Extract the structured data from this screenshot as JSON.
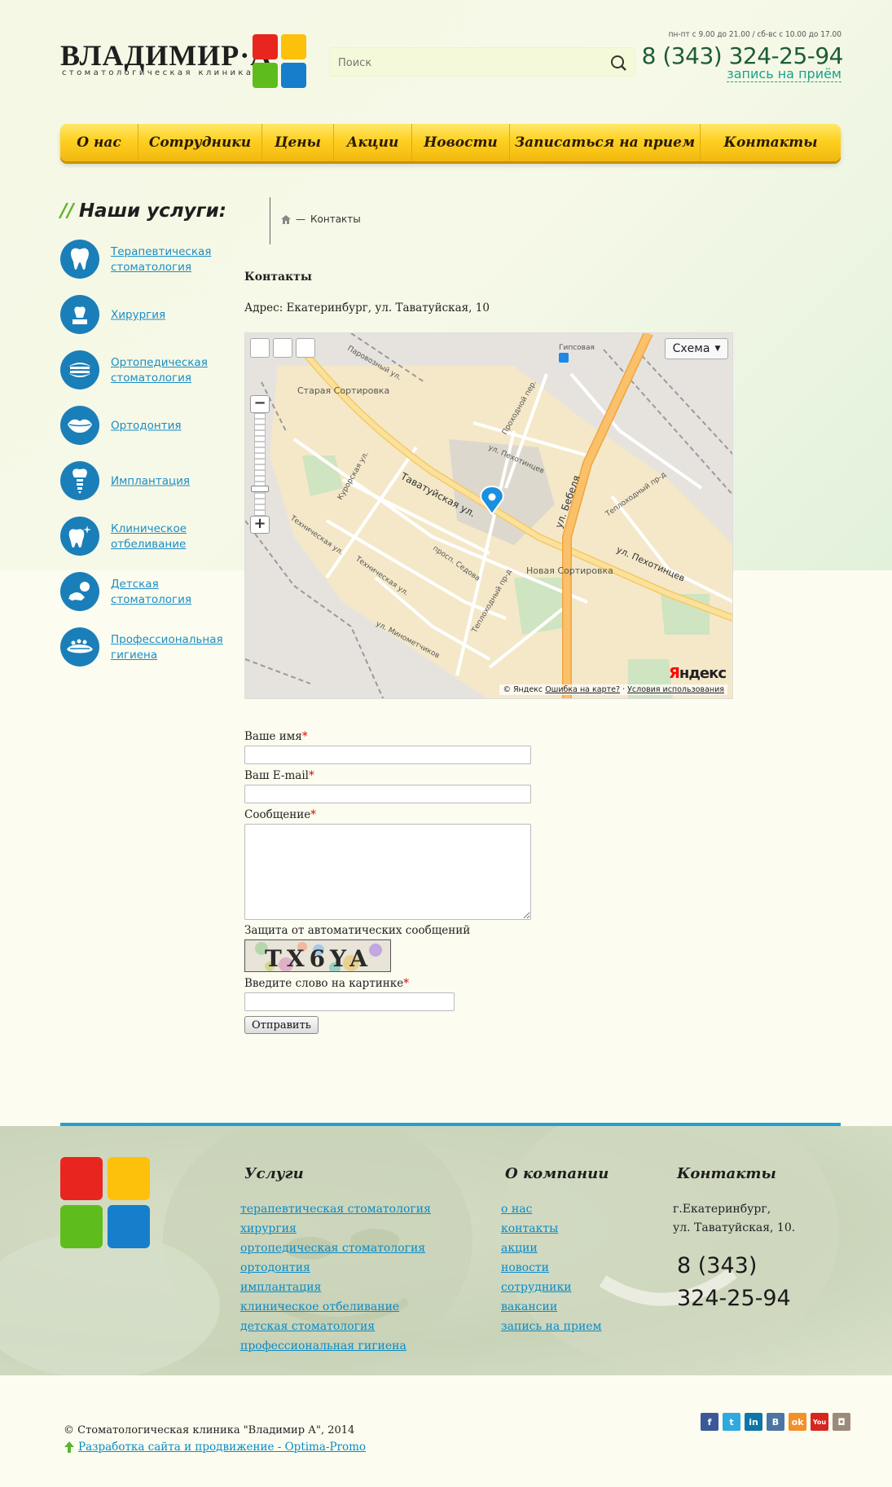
{
  "header": {
    "logo_text": "ВЛАДИМИР·А",
    "logo_subtitle": "стоматологическая клиника",
    "logo_colors": [
      "#e8261f",
      "#fdc10c",
      "#5ebd1c",
      "#157fcb"
    ],
    "search_placeholder": "Поиск",
    "hours": "пн-пт с 9.00 до 21.00 / сб-вс с 10.00 до 17.00",
    "phone": "8 (343) 324-25-94",
    "appointment_link": "запись на приём"
  },
  "menu": [
    {
      "label": "О нас"
    },
    {
      "label": "Сотрудники"
    },
    {
      "label": "Цены"
    },
    {
      "label": "Акции"
    },
    {
      "label": "Новости"
    },
    {
      "label": "Записаться на прием"
    },
    {
      "label": "Контакты"
    }
  ],
  "sidebar": {
    "title": "Наши услуги:",
    "items": [
      {
        "label": "Терапевтическая стоматология",
        "icon": "tooth-icon"
      },
      {
        "label": "Хирургия",
        "icon": "surgery-tooth-icon"
      },
      {
        "label": "Ортопедическая стоматология",
        "icon": "denture-icon"
      },
      {
        "label": "Ортодонтия",
        "icon": "lips-icon"
      },
      {
        "label": "Имплантация",
        "icon": "implant-icon"
      },
      {
        "label": "Клиническое отбеливание",
        "icon": "whitening-tooth-icon"
      },
      {
        "label": "Детская стоматология",
        "icon": "child-icon"
      },
      {
        "label": "Профессиональная гигиена",
        "icon": "hygiene-icon"
      }
    ]
  },
  "breadcrumb": {
    "separator": "—",
    "current": "Контакты"
  },
  "content": {
    "title": "Контакты",
    "address": "Адрес: Екатеринбург, ул. Таватуйская, 10"
  },
  "map": {
    "schema_label": "Схема",
    "labels": {
      "staraya": "Старая Сортировка",
      "tavatuyskaya": "Таватуйская ул.",
      "bebelya": "ул. Бебеля",
      "pekhotintsev": "ул. Пехотинцев",
      "pekhotintsev2": "ул. Пехотинцев",
      "novaya": "Новая Сортировка",
      "tekhnicheskaya": "Техническая ул.",
      "tekhnicheskaya2": "Техническая ул.",
      "kurorskaya": "Курорская ул.",
      "sedova": "просп. Седова",
      "teplokhodnyy": "Теплоходный пр-д",
      "teplokhodnyy2": "Теплоходный пр-д",
      "minometchikov": "ул. Минометчиков",
      "prokhodnoy": "Проходной пер.",
      "gipsovaya": "Гипсовая",
      "parovozny": "Паровозный ул."
    },
    "copyright": "© Яндекс",
    "error_link": "Ошибка на карте?",
    "terms_link": "Условия использования",
    "brand": "Яндекс"
  },
  "form": {
    "name_label": "Ваше имя",
    "email_label": "Ваш E-mail",
    "message_label": "Сообщение",
    "required_mark": "*",
    "captcha_title": "Защита от автоматических сообщений",
    "captcha_text": "TX6YA",
    "captcha_label": "Введите слово на картинке",
    "submit_label": "Отправить"
  },
  "footer": {
    "services_title": "Услуги",
    "services": [
      "терапевтическая стоматология",
      "хирургия",
      "ортопедическая стоматология",
      "ортодонтия",
      "имплантация",
      "клиническое отбеливание",
      "детская стоматология",
      "профессиональная гигиена"
    ],
    "company_title": "О компании",
    "company": [
      "о нас",
      "контакты",
      "акции",
      "новости",
      "сотрудники",
      "вакансии",
      "запись на прием"
    ],
    "contacts_title": "Контакты",
    "city": "г.Екатеринбург,",
    "street": "ул. Таватуйская, 10.",
    "phone_line1": "8 (343)",
    "phone_line2": "324-25-94",
    "copyright": "© Стоматологическая клиника \"Владимир А\", 2014",
    "developer_link": "Разработка сайта и продвижение - Optima-Promo",
    "socials": [
      {
        "icon": "facebook-icon",
        "glyph": "f",
        "color": "#3b5998"
      },
      {
        "icon": "twitter-icon",
        "glyph": "t",
        "color": "#2fa9e0"
      },
      {
        "icon": "linkedin-icon",
        "glyph": "in",
        "color": "#0e76a8"
      },
      {
        "icon": "vkontakte-icon",
        "glyph": "B",
        "color": "#4c75a3"
      },
      {
        "icon": "odnoklassniki-icon",
        "glyph": "ok",
        "color": "#f4902a"
      },
      {
        "icon": "youtube-icon",
        "glyph": "You",
        "color": "#d7261f"
      },
      {
        "icon": "instagram-icon",
        "glyph": "◘",
        "color": "#9c8b7b"
      }
    ]
  }
}
